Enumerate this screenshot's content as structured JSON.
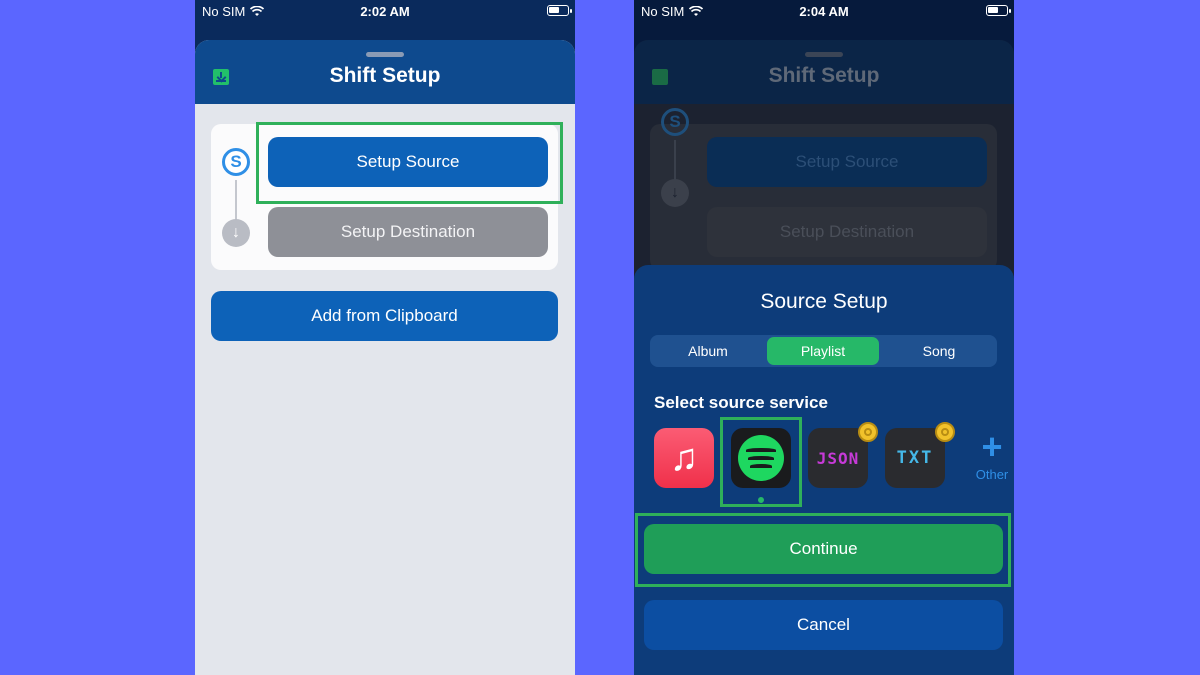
{
  "left": {
    "status": {
      "carrier": "No SIM",
      "time": "2:02 AM"
    },
    "sheet_title": "Shift Setup",
    "steps": {
      "source_icon_letter": "S",
      "arrow_glyph": "↓",
      "setup_source_label": "Setup Source",
      "setup_destination_label": "Setup Destination"
    },
    "add_clipboard_label": "Add from Clipboard"
  },
  "right": {
    "status": {
      "carrier": "No SIM",
      "time": "2:04 AM"
    },
    "background_title": "Shift Setup",
    "background_source_label": "Setup Source",
    "background_destination_label": "Setup Destination",
    "source_setup": {
      "title": "Source Setup",
      "tabs": [
        {
          "label": "Album",
          "selected": false
        },
        {
          "label": "Playlist",
          "selected": true
        },
        {
          "label": "Song",
          "selected": false
        }
      ],
      "subtitle": "Select source service",
      "services": [
        {
          "name": "apple-music-icon"
        },
        {
          "name": "spotify-icon",
          "selected": true
        },
        {
          "name": "json-icon",
          "label": "JSON",
          "premium": true
        },
        {
          "name": "txt-icon",
          "label": "TXT",
          "premium": true
        }
      ],
      "other_label": "Other",
      "continue_label": "Continue",
      "cancel_label": "Cancel"
    }
  },
  "colors": {
    "page_background": "#5b66ff",
    "primary_blue": "#0d62b8",
    "accent_green": "#26b868",
    "highlight_green": "#2fb05a"
  }
}
